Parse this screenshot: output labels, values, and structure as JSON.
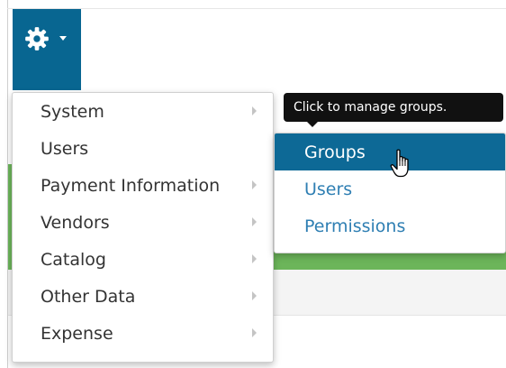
{
  "header": {
    "settings_button": {
      "icon": "gear-icon",
      "dropdown_indicator": "caret-down-icon",
      "background_color": "#086691"
    }
  },
  "main_menu": {
    "items": [
      {
        "label": "System",
        "has_submenu": true
      },
      {
        "label": "Users",
        "has_submenu": false
      },
      {
        "label": "Payment Information",
        "has_submenu": true
      },
      {
        "label": "Vendors",
        "has_submenu": true
      },
      {
        "label": "Catalog",
        "has_submenu": true
      },
      {
        "label": "Other Data",
        "has_submenu": true
      },
      {
        "label": "Expense",
        "has_submenu": true
      }
    ]
  },
  "tooltip": {
    "text": "Click to manage groups."
  },
  "submenu": {
    "items": [
      {
        "label": "Groups",
        "active": true
      },
      {
        "label": "Users",
        "active": false
      },
      {
        "label": "Permissions",
        "active": false
      }
    ],
    "active_color": "#0d6996",
    "link_color": "#2f7fb3"
  },
  "pointer": {
    "icon": "hand-pointer-icon"
  },
  "page": {
    "accent_strip_color": "#6cb55a"
  }
}
